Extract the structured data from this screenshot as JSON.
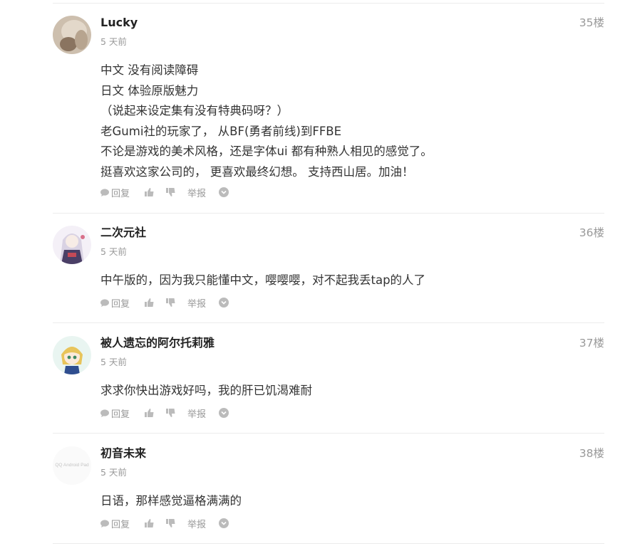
{
  "comments": [
    {
      "author": "Lucky",
      "time": "5 天前",
      "floor": "35楼",
      "lines": [
        "中文 没有阅读障碍",
        "日文 体验原版魅力",
        "（说起来设定集有没有特典码呀？）",
        "老Gumi社的玩家了， 从BF(勇者前线)到FFBE",
        "不论是游戏的美术风格，还是字体ui 都有种熟人相见的感觉了。",
        "挺喜欢这家公司的， 更喜欢最终幻想。 支持西山居。加油！"
      ]
    },
    {
      "author": "二次元社",
      "time": "5 天前",
      "floor": "36楼",
      "lines": [
        "中午版的，因为我只能懂中文，嘤嘤嘤，对不起我丢tap的人了"
      ]
    },
    {
      "author": "被人遗忘的阿尔托莉雅",
      "time": "5 天前",
      "floor": "37楼",
      "lines": [
        "求求你快出游戏好吗，我的肝已饥渴难耐"
      ]
    },
    {
      "author": "初音未来",
      "time": "5 天前",
      "floor": "38楼",
      "avatar_text": "QQ Android Pad",
      "lines": [
        "日语，那样感觉逼格满满的"
      ]
    }
  ],
  "actions": {
    "reply": "回复",
    "report": "举报"
  },
  "icons": [
    "comment-bubble-icon",
    "thumbs-up-icon",
    "thumbs-down-icon",
    "chevron-down-circle-icon"
  ],
  "colors": {
    "text": "#333333",
    "muted": "#999999",
    "icon": "#bbbbbb",
    "divider": "#ececec"
  }
}
